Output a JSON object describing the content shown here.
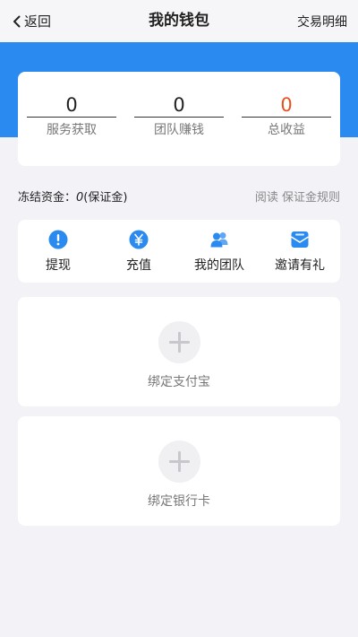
{
  "header": {
    "back_label": "返回",
    "title": "我的钱包",
    "right_link": "交易明细"
  },
  "stats": [
    {
      "value": "0",
      "label": "服务获取"
    },
    {
      "value": "0",
      "label": "团队赚钱"
    },
    {
      "value": "0",
      "label": "总收益"
    }
  ],
  "frozen": {
    "label": "冻结资金：",
    "value": "0",
    "suffix": "(保证金)",
    "link": "阅读 保证金规则"
  },
  "actions": [
    {
      "label": "提现",
      "icon": "exclamation-circle-icon"
    },
    {
      "label": "充值",
      "icon": "yen-circle-icon"
    },
    {
      "label": "我的团队",
      "icon": "team-icon"
    },
    {
      "label": "邀请有礼",
      "icon": "invite-envelope-icon"
    }
  ],
  "bind": {
    "alipay_label": "绑定支付宝",
    "bank_label": "绑定银行卡"
  },
  "colors": {
    "accent_blue": "#2a8af0",
    "income_red": "#e8501f"
  }
}
